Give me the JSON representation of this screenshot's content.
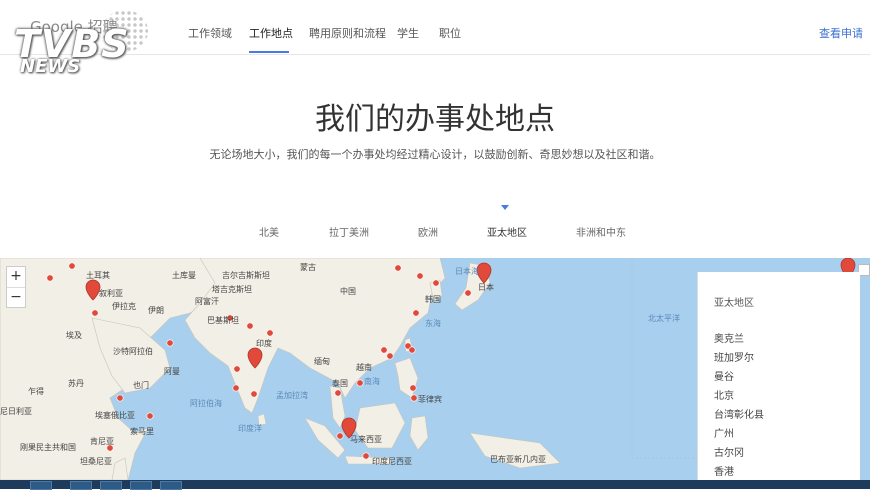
{
  "header": {
    "logo_text": "Google 招聘",
    "watermark": {
      "main": "TVBS",
      "sub": "NEWS"
    },
    "nav": [
      {
        "label": "工作领域",
        "active": false
      },
      {
        "label": "工作地点",
        "active": true
      },
      {
        "label": "聘用原则和流程",
        "active": false
      },
      {
        "label": "学生",
        "active": false
      },
      {
        "label": "职位",
        "active": false
      }
    ],
    "apply_link": "查看申请"
  },
  "hero": {
    "title": "我们的办事处地点",
    "subtitle": "无论场地大小，我们的每一个办事处均经过精心设计，以鼓励创新、奇思妙想以及社区和谐。"
  },
  "region_tabs": [
    {
      "label": "北美",
      "active": false
    },
    {
      "label": "拉丁美洲",
      "active": false
    },
    {
      "label": "欧洲",
      "active": false
    },
    {
      "label": "亚太地区",
      "active": true
    },
    {
      "label": "非洲和中东",
      "active": false
    }
  ],
  "map": {
    "zoom_in": "+",
    "zoom_out": "−",
    "labels": {
      "turkey": "土耳其",
      "syria": "叙利亚",
      "iraq": "伊拉克",
      "iran": "伊朗",
      "afghanistan": "阿富汗",
      "pakistan": "巴基斯坦",
      "egypt": "埃及",
      "saudi": "沙特阿拉伯",
      "oman": "阿曼",
      "yemen": "也门",
      "sudan": "苏丹",
      "chad": "乍得",
      "nigeria": "尼日利亚",
      "ethiopia": "埃塞俄比亚",
      "somalia": "索马里",
      "kenya": "肯尼亚",
      "drc": "刚果民主共和国",
      "tanzania": "坦桑尼亚",
      "turkmen": "土库曼",
      "tajik": "塔吉克斯坦",
      "kyrgyz": "吉尔吉斯斯坦",
      "mongolia": "蒙古",
      "china": "中国",
      "india": "印度",
      "myanmar": "缅甸",
      "thailand": "泰国",
      "vietnam": "越南",
      "philippines": "菲律宾",
      "malaysia": "马来西亚",
      "indonesia": "印度尼西亚",
      "japan": "日本",
      "korea": "韩国",
      "east_china_sea": "东海",
      "south_china_sea": "南海",
      "sea_of_japan": "日本海",
      "arabian_sea": "阿拉伯海",
      "bay_of_bengal": "孟加拉湾",
      "indian_ocean": "印度洋",
      "north_pacific": "北太平洋",
      "png": "巴布亚新几内亚"
    },
    "colors": {
      "water": "#a8d0ee",
      "land": "#f2efe6",
      "pin": "#e14a3b"
    },
    "panel": {
      "heading": "亚太地区",
      "cities": [
        "奥克兰",
        "班加罗尔",
        "曼谷",
        "北京",
        "台湾彰化县",
        "广州",
        "古尔冈",
        "香港"
      ]
    }
  }
}
